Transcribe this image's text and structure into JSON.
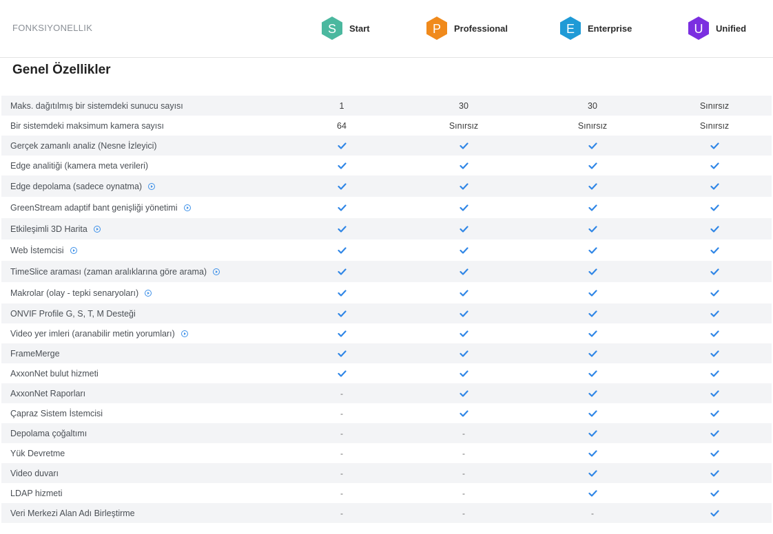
{
  "header": {
    "label": "FONKSIYONELLIK",
    "plans": [
      {
        "letter": "S",
        "name": "Start",
        "color": "#4bb89f"
      },
      {
        "letter": "P",
        "name": "Professional",
        "color": "#f08a1c"
      },
      {
        "letter": "E",
        "name": "Enterprise",
        "color": "#1f9ad6"
      },
      {
        "letter": "U",
        "name": "Unified",
        "color": "#7b2fe0"
      }
    ]
  },
  "section": {
    "title": "Genel Özellikler"
  },
  "accent_color": "#2f86e6",
  "rows": [
    {
      "feature": "Maks. dağıtılmış bir sistemdeki sunucu sayısı",
      "info": false,
      "values": [
        "1",
        "30",
        "30",
        "Sınırsız"
      ]
    },
    {
      "feature": "Bir sistemdeki maksimum kamera sayısı",
      "info": false,
      "values": [
        "64",
        "Sınırsız",
        "Sınırsız",
        "Sınırsız"
      ]
    },
    {
      "feature": "Gerçek zamanlı analiz (Nesne İzleyici)",
      "info": false,
      "values": [
        "check",
        "check",
        "check",
        "check"
      ]
    },
    {
      "feature": "Edge analitiği (kamera meta verileri)",
      "info": false,
      "values": [
        "check",
        "check",
        "check",
        "check"
      ]
    },
    {
      "feature": "Edge depolama (sadece oynatma)",
      "info": true,
      "values": [
        "check",
        "check",
        "check",
        "check"
      ]
    },
    {
      "feature": "GreenStream adaptif bant genişliği yönetimi",
      "info": true,
      "values": [
        "check",
        "check",
        "check",
        "check"
      ]
    },
    {
      "feature": "Etkileşimli 3D Harita",
      "info": true,
      "values": [
        "check",
        "check",
        "check",
        "check"
      ]
    },
    {
      "feature": "Web İstemcisi",
      "info": true,
      "values": [
        "check",
        "check",
        "check",
        "check"
      ]
    },
    {
      "feature": "TimeSlice araması (zaman aralıklarına göre arama)",
      "info": true,
      "values": [
        "check",
        "check",
        "check",
        "check"
      ]
    },
    {
      "feature": "Makrolar (olay - tepki senaryoları)",
      "info": true,
      "values": [
        "check",
        "check",
        "check",
        "check"
      ]
    },
    {
      "feature": "ONVIF Profile G, S, T, M Desteği",
      "info": false,
      "values": [
        "check",
        "check",
        "check",
        "check"
      ]
    },
    {
      "feature": "Video yer imleri (aranabilir metin yorumları)",
      "info": true,
      "values": [
        "check",
        "check",
        "check",
        "check"
      ]
    },
    {
      "feature": "FrameMerge",
      "info": false,
      "values": [
        "check",
        "check",
        "check",
        "check"
      ]
    },
    {
      "feature": "AxxonNet bulut hizmeti",
      "info": false,
      "values": [
        "check",
        "check",
        "check",
        "check"
      ]
    },
    {
      "feature": "AxxonNet Raporları",
      "info": false,
      "values": [
        "-",
        "check",
        "check",
        "check"
      ]
    },
    {
      "feature": "Çapraz Sistem İstemcisi",
      "info": false,
      "values": [
        "-",
        "check",
        "check",
        "check"
      ]
    },
    {
      "feature": "Depolama çoğaltımı",
      "info": false,
      "values": [
        "-",
        "-",
        "check",
        "check"
      ]
    },
    {
      "feature": "Yük Devretme",
      "info": false,
      "values": [
        "-",
        "-",
        "check",
        "check"
      ]
    },
    {
      "feature": "Video duvarı",
      "info": false,
      "values": [
        "-",
        "-",
        "check",
        "check"
      ]
    },
    {
      "feature": "LDAP hizmeti",
      "info": false,
      "values": [
        "-",
        "-",
        "check",
        "check"
      ]
    },
    {
      "feature": "Veri Merkezi Alan Adı Birleştirme",
      "info": false,
      "values": [
        "-",
        "-",
        "-",
        "check"
      ]
    }
  ]
}
